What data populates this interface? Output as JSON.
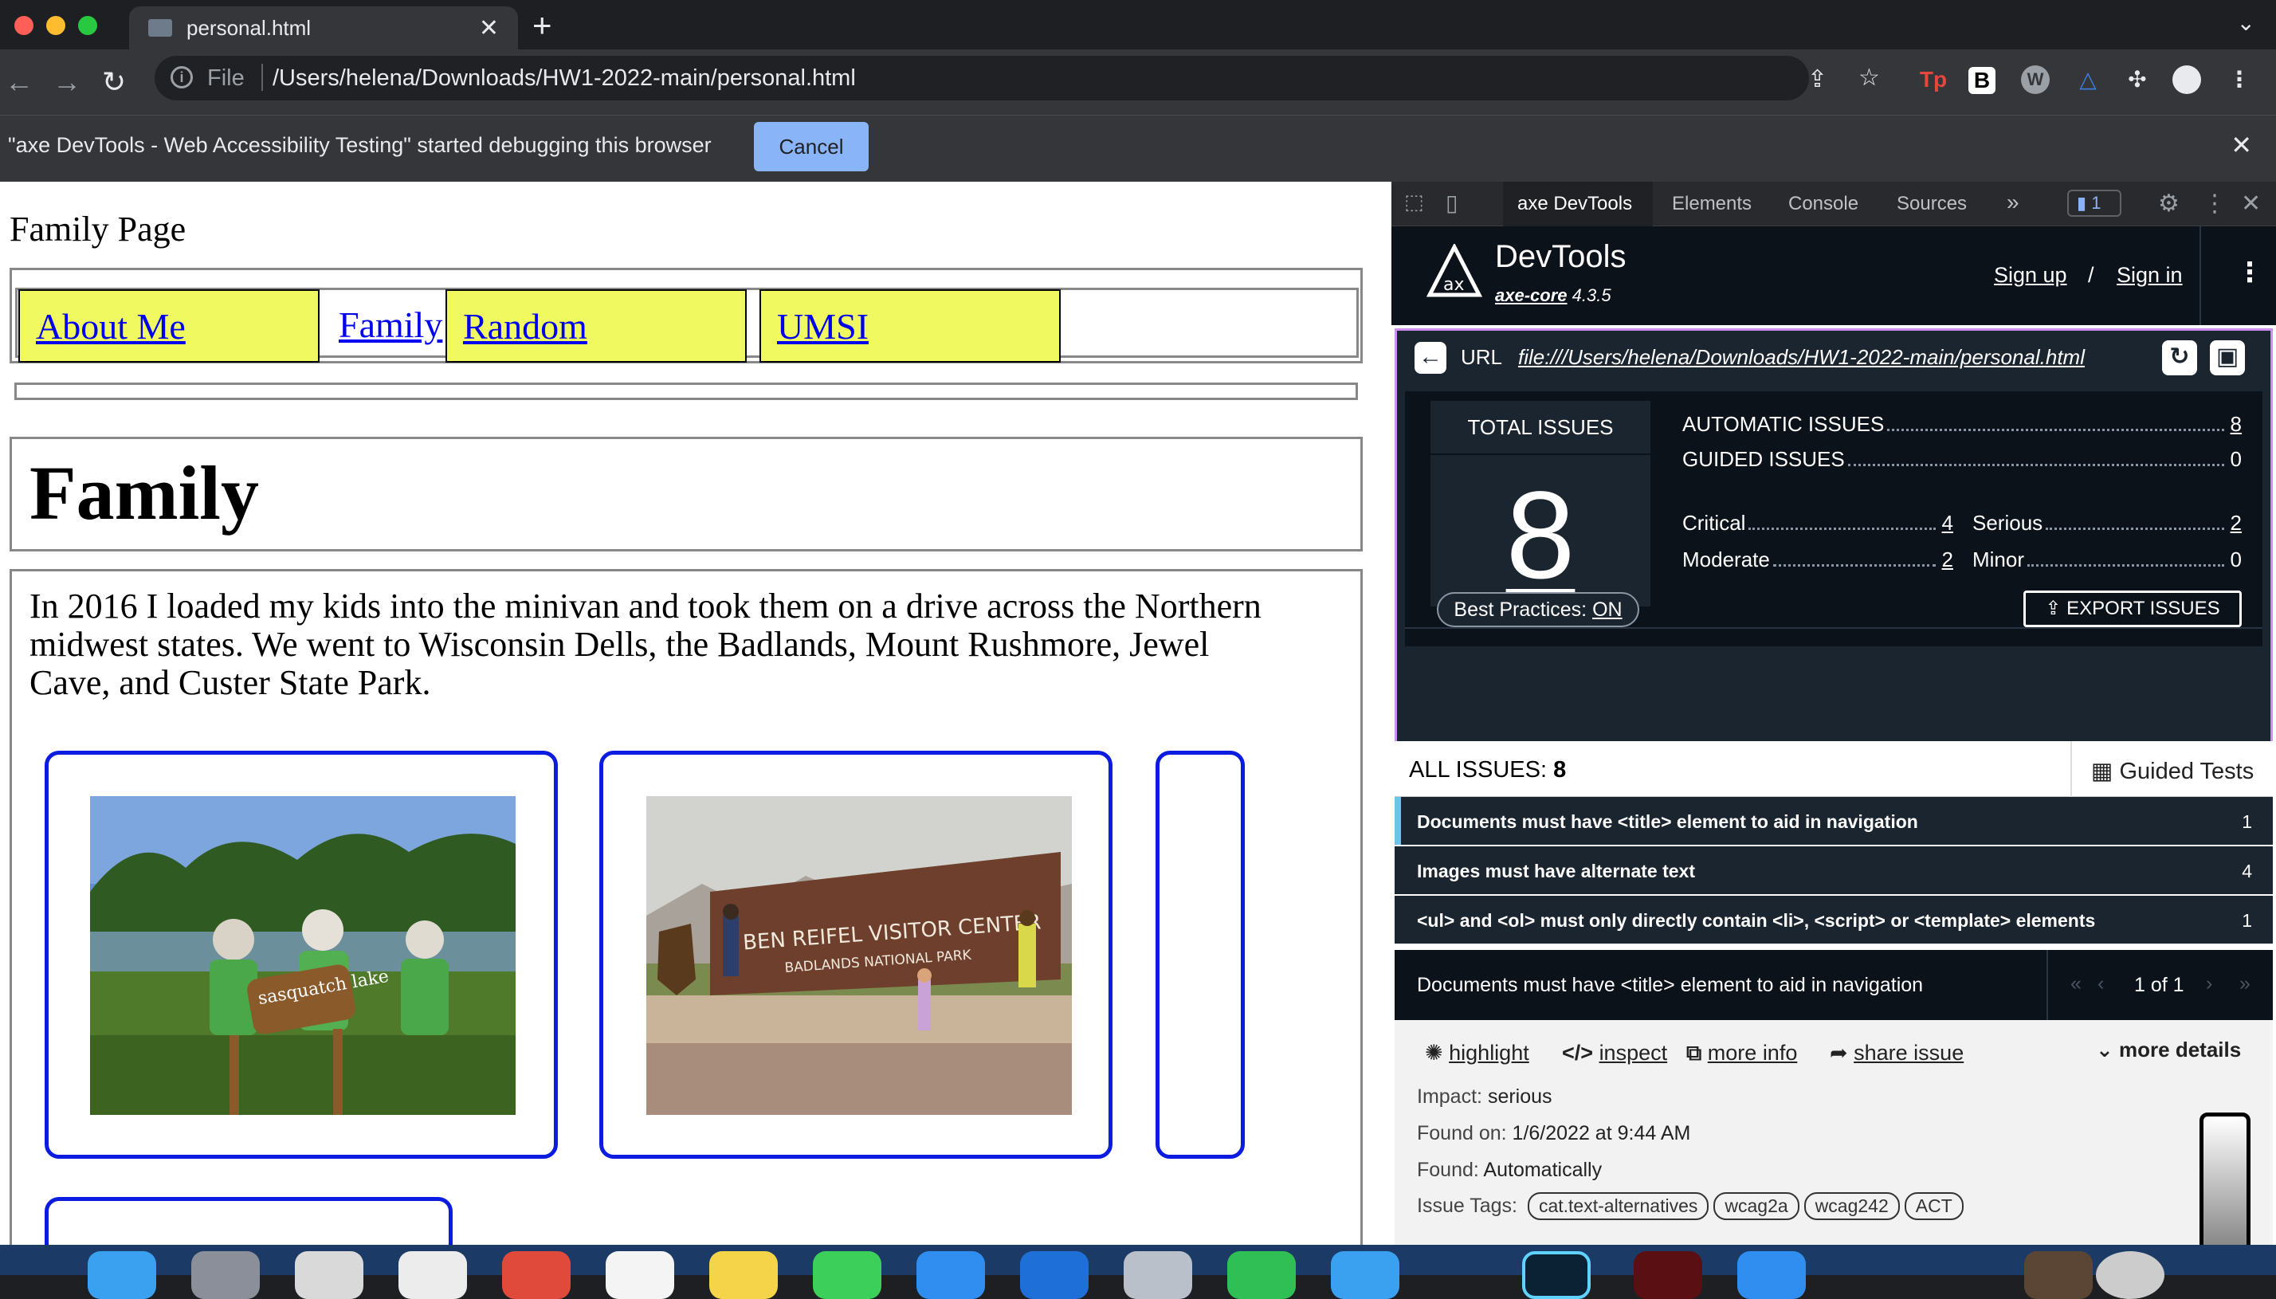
{
  "browser": {
    "tab_title": "personal.html",
    "omnibox": {
      "scheme_label": "File",
      "url": "/Users/helena/Downloads/HW1-2022-main/personal.html"
    },
    "infobar": {
      "message": "\"axe DevTools - Web Accessibility Testing\" started debugging this browser",
      "cancel_label": "Cancel"
    },
    "extensions": [
      "Tp",
      "B",
      "W"
    ]
  },
  "page": {
    "title": "Family Page",
    "nav": [
      "About Me",
      "Family",
      "Random",
      "UMSI"
    ],
    "heading": "Family",
    "paragraph": "In 2016 I loaded my kids into the minivan and took them on a drive across the Northern midwest states. We went to Wisconsin Dells, the Badlands, Mount Rushmore, Jewel Cave, and Custer State Park.",
    "photo1_sign": "sasquatch lake",
    "photo2_sign": [
      "BEN REIFEL VISITOR CENTER",
      "BADLANDS NATIONAL PARK"
    ]
  },
  "devtools": {
    "tabs": [
      "axe DevTools",
      "Elements",
      "Console",
      "Sources",
      "»"
    ],
    "issues_badge": "1",
    "axe": {
      "brand": "DevTools",
      "core_label": "axe-core",
      "core_version": "4.3.5",
      "sign_up": "Sign up",
      "slash": "/",
      "sign_in": "Sign in",
      "url_label": "URL",
      "url": "file:///Users/helena/Downloads/HW1-2022-main/personal.html",
      "total_label": "TOTAL ISSUES",
      "total": "8",
      "automatic_label": "AUTOMATIC ISSUES",
      "automatic": "8",
      "guided_label": "GUIDED ISSUES",
      "guided": "0",
      "critical_label": "Critical",
      "critical": "4",
      "serious_label": "Serious",
      "serious": "2",
      "moderate_label": "Moderate",
      "moderate": "2",
      "minor_label": "Minor",
      "minor": "0",
      "best_practices_label": "Best Practices:",
      "best_practices_value": "ON",
      "export_label": "EXPORT ISSUES",
      "all_issues_label": "ALL ISSUES:",
      "all_issues_count": "8",
      "guided_tests_label": "Guided Tests",
      "issues": [
        {
          "title": "Documents must have <title> element to aid in navigation",
          "count": "1"
        },
        {
          "title": "Images must have alternate text",
          "count": "4"
        },
        {
          "title": "<ul> and <ol> must only directly contain <li>, <script> or <template> elements",
          "count": "1"
        }
      ],
      "selected_issue": "Documents must have <title> element to aid in navigation",
      "pager": "1 of 1",
      "actions": {
        "highlight": "highlight",
        "inspect": "inspect",
        "more_info": "more info",
        "share": "share issue",
        "more_details": "more details"
      },
      "details": {
        "impact_label": "Impact:",
        "impact": "serious",
        "found_on_label": "Found on:",
        "found_on": "1/6/2022 at 9:44 AM",
        "found_label": "Found:",
        "found": "Automatically",
        "tags_label": "Issue Tags:",
        "tags": [
          "cat.text-alternatives",
          "wcag2a",
          "wcag242",
          "ACT"
        ]
      }
    }
  },
  "colors": {
    "card_border": "#0b1be0",
    "nav_highlight": "#f0fa60",
    "axe_dark": "#0c121a",
    "axe_panel": "#1b2530",
    "accent_frame": "#cf8ff0"
  }
}
